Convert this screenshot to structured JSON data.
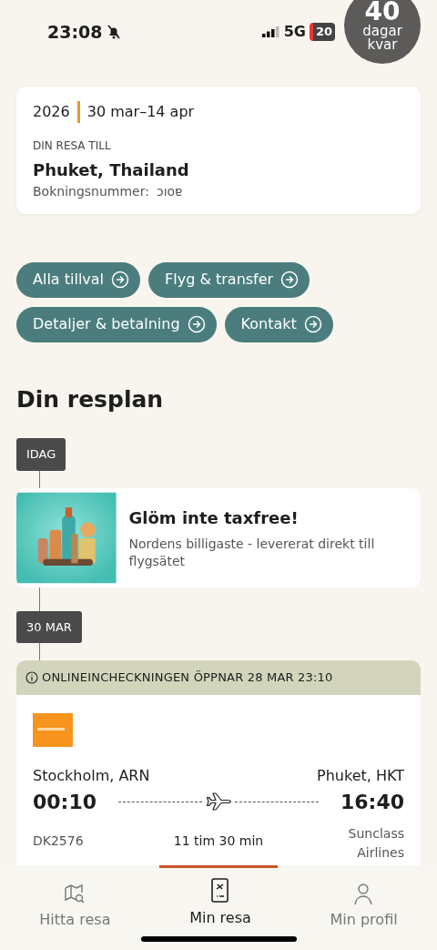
{
  "status_bar": {
    "time": "23:08",
    "network": "5G",
    "battery": "20"
  },
  "countdown": {
    "number": "40",
    "line_1": "dagar",
    "line_2": "kvar"
  },
  "trip": {
    "year": "2026",
    "dates": "30 mar–14 apr",
    "eyebrow": "DIN RESA TILL",
    "destination": "Phuket, Thailand",
    "booking_label": "Bokningsnummer:",
    "booking_number": "ɔıoɐ"
  },
  "quick_links": [
    {
      "label": "Alla tillval"
    },
    {
      "label": "Flyg & transfer"
    },
    {
      "label": "Detaljer & betalning"
    },
    {
      "label": "Kontakt"
    }
  ],
  "itinerary": {
    "title": "Din resplan",
    "events": [
      {
        "kind": "date",
        "label": "IDAG"
      },
      {
        "kind": "promo",
        "title": "Glöm inte taxfree!",
        "text": "Nordens billigaste - levererat direkt till flygsätet"
      },
      {
        "kind": "date",
        "label": "30 MAR"
      },
      {
        "kind": "flight",
        "notice": "ONLINEINCHECKNINGEN ÖPPNAR 28 MAR 23:10",
        "from": "Stockholm, ARN",
        "to": "Phuket, HKT",
        "departure": "00:10",
        "arrival": "16:40",
        "flight_number": "DK2576",
        "duration": "11 tim 30 min",
        "airline": "Sunclass Airlines"
      }
    ]
  },
  "bottom_nav": [
    {
      "kind": "map",
      "label": "Hitta resa",
      "selected": false
    },
    {
      "kind": "ticket",
      "label": "Min resa",
      "selected": true
    },
    {
      "kind": "person",
      "label": "Min profil",
      "selected": false
    }
  ]
}
